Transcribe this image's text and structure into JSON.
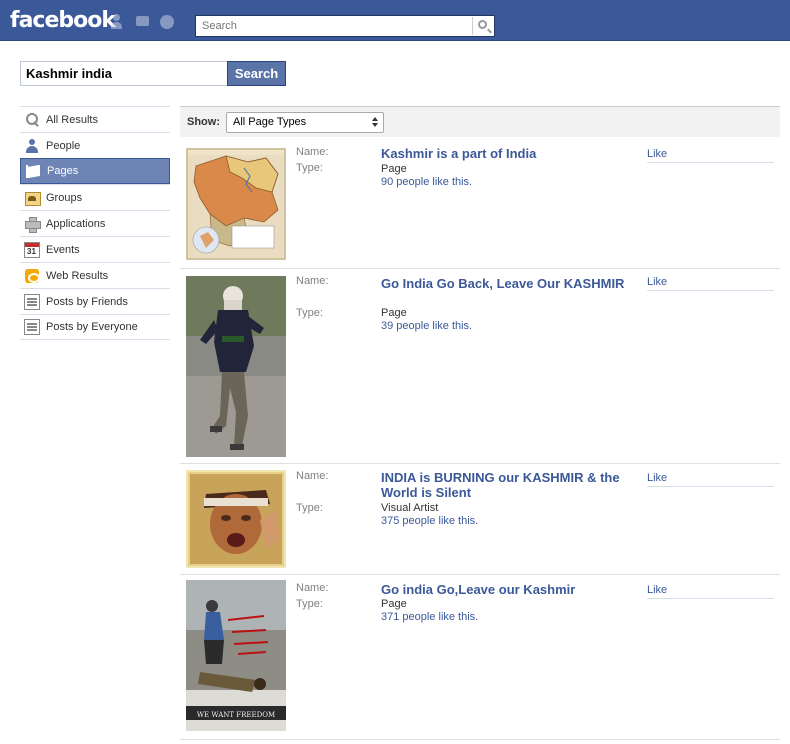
{
  "header": {
    "logo": "facebook",
    "search_placeholder": "Search"
  },
  "search": {
    "query": "Kashmir india",
    "button_label": "Search"
  },
  "nav": {
    "items": [
      {
        "label": "All Results",
        "icon": "magnifier-icon"
      },
      {
        "label": "People",
        "icon": "person-icon"
      },
      {
        "label": "Pages",
        "icon": "flag-icon",
        "active": true
      },
      {
        "label": "Groups",
        "icon": "groups-icon"
      },
      {
        "label": "Applications",
        "icon": "applications-icon"
      },
      {
        "label": "Events",
        "icon": "calendar-icon"
      },
      {
        "label": "Web Results",
        "icon": "web-icon"
      },
      {
        "label": "Posts by Friends",
        "icon": "posts-icon"
      },
      {
        "label": "Posts by Everyone",
        "icon": "posts-icon"
      }
    ]
  },
  "filter": {
    "show_label": "Show:",
    "selected": "All Page Types"
  },
  "labels": {
    "name": "Name:",
    "type": "Type:"
  },
  "results": [
    {
      "name": "Kashmir is a part of India",
      "type": "Page",
      "likes": "90 people like this.",
      "like": "Like",
      "thumb": "map-of-kashmir"
    },
    {
      "name": "Go India Go Back, Leave Our KASHMIR",
      "type": "Page",
      "likes": "39 people like this.",
      "like": "Like",
      "thumb": "running-protester"
    },
    {
      "name": "INDIA is BURNING our KASHMIR & the World is Silent",
      "type": "Visual Artist",
      "likes": "375 people like this.",
      "like": "Like",
      "thumb": "crying-woman"
    },
    {
      "name": "Go india Go,Leave our Kashmir",
      "type": "Page",
      "likes": "371 people like this.",
      "like": "Like",
      "thumb": "protest-poster",
      "poster_text": "WE WANT FREEDOM"
    }
  ],
  "colors": {
    "brand": "#3b5998",
    "active_nav": "#6d84b4",
    "link": "#3b5998"
  }
}
